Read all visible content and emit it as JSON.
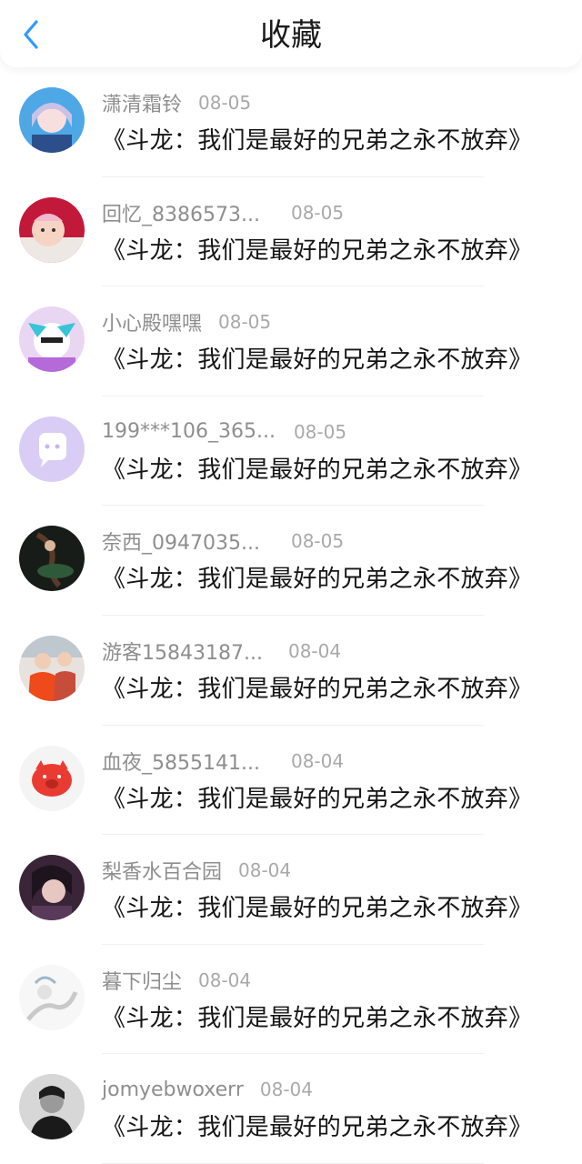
{
  "header": {
    "title": "收藏"
  },
  "items": [
    {
      "username": "潇清霜铃",
      "date": "08-05",
      "title": "《斗龙：我们是最好的兄弟之永不放弃》"
    },
    {
      "username": "回忆_8386573...",
      "date": "08-05",
      "title": "《斗龙：我们是最好的兄弟之永不放弃》"
    },
    {
      "username": "小心殿嘿嘿",
      "date": "08-05",
      "title": "《斗龙：我们是最好的兄弟之永不放弃》"
    },
    {
      "username": "199***106_365...",
      "date": "08-05",
      "title": "《斗龙：我们是最好的兄弟之永不放弃》"
    },
    {
      "username": "奈西_0947035...",
      "date": "08-05",
      "title": "《斗龙：我们是最好的兄弟之永不放弃》"
    },
    {
      "username": "游客15843187...",
      "date": "08-04",
      "title": "《斗龙：我们是最好的兄弟之永不放弃》"
    },
    {
      "username": "血夜_5855141...",
      "date": "08-04",
      "title": "《斗龙：我们是最好的兄弟之永不放弃》"
    },
    {
      "username": "梨香水百合园",
      "date": "08-04",
      "title": "《斗龙：我们是最好的兄弟之永不放弃》"
    },
    {
      "username": "暮下归尘",
      "date": "08-04",
      "title": "《斗龙：我们是最好的兄弟之永不放弃》"
    },
    {
      "username": "jomyebwoxerr",
      "date": "08-04",
      "title": "《斗龙：我们是最好的兄弟之永不放弃》"
    }
  ]
}
